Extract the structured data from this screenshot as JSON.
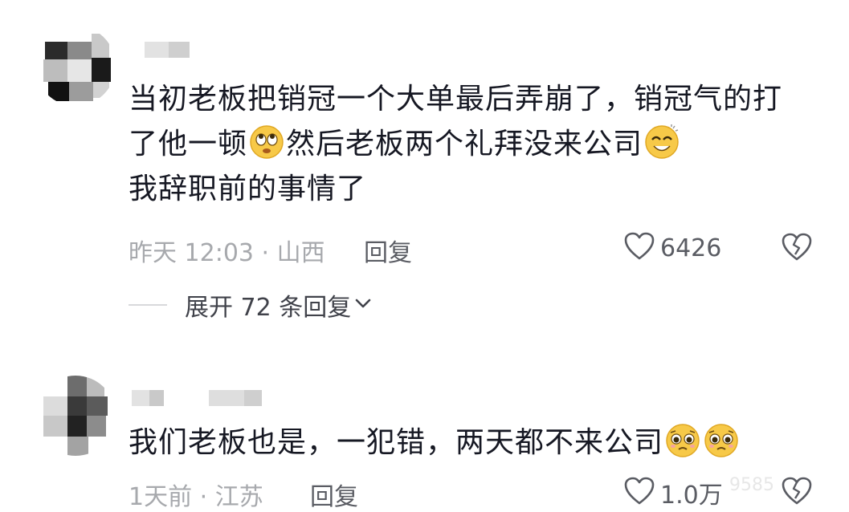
{
  "comments": [
    {
      "lines": [
        "当初老板把销冠一个大单最后弄崩了，销冠气的打",
        "了他一顿",
        "然后老板两个礼拜没来公司",
        "我辞职前的事情了"
      ],
      "time_location": "昨天 12:03 · 山西",
      "reply_label": "回复",
      "like_count": "6426",
      "emojis": [
        "rolling-eyes-emoji",
        "smiling-squint-emoji"
      ]
    },
    {
      "text": "我们老板也是，一犯错，两天都不来公司",
      "time_location": "1天前 · 江苏",
      "reply_label": "回复",
      "like_count": "1.0万",
      "emojis": [
        "pleading-emoji",
        "pleading-emoji"
      ]
    }
  ],
  "expand_replies": "展开 72 条回复",
  "watermark": "9585",
  "colors": {
    "text_primary": "#161823",
    "text_meta": "#a7a9ad",
    "action": "#5a5c63",
    "emoji_face": "#f7c948"
  }
}
